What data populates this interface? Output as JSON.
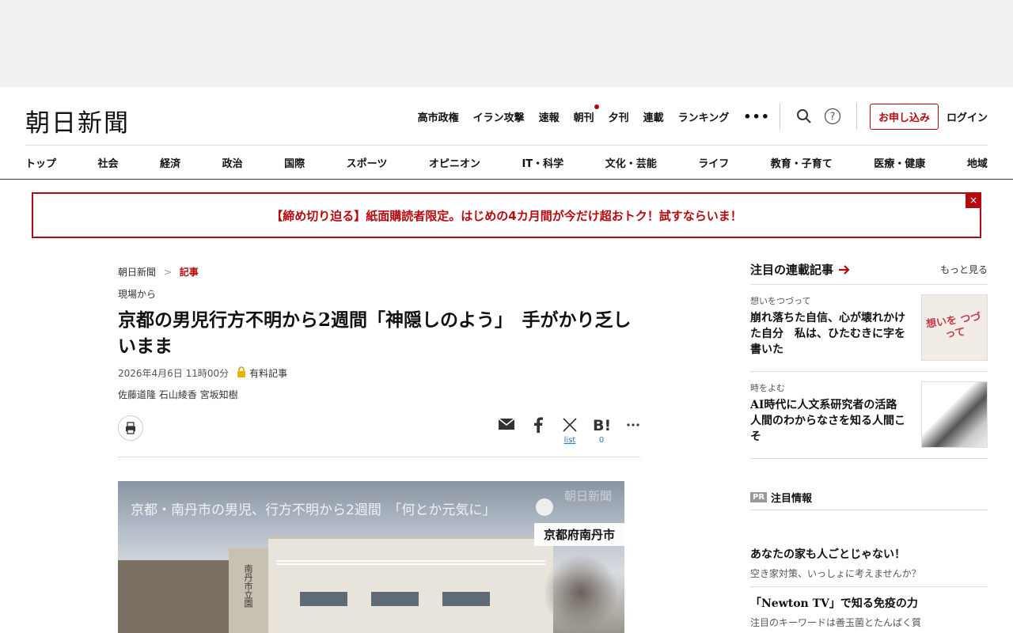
{
  "masthead": {
    "logo": "朝日新聞"
  },
  "topnav": {
    "links": [
      "高市政権",
      "イラン攻撃",
      "速報",
      "朝刊",
      "夕刊",
      "連載",
      "ランキング"
    ],
    "more": "•••",
    "subscribe": "お申し込み",
    "login": "ログイン"
  },
  "categories": [
    "トップ",
    "社会",
    "経済",
    "政治",
    "国際",
    "スポーツ",
    "オピニオン",
    "IT・科学",
    "文化・芸能",
    "ライフ",
    "教育・子育て",
    "医療・健康",
    "地域"
  ],
  "promo": {
    "text": "【締め切り迫る】紙面購読者限定。はじめの4カ月間が今だけ超おトク！試すならいま！",
    "close": "×"
  },
  "breadcrumb": {
    "home": "朝日新聞",
    "sep": ">",
    "current": "記事"
  },
  "article": {
    "kicker": "現場から",
    "headline": "京都の男児行方不明から2週間「神隠しのよう」　手がかり乏しいまま",
    "date": "2026年4月6日 11時00分",
    "paid": "有料記事",
    "authors": "佐藤道隆 石山綾香 宮坂知樹"
  },
  "share": {
    "x_count": "list",
    "hatena_count": "0"
  },
  "photo": {
    "caption": "京都・南丹市の男児、行方不明から2週間　「何とか元気に」",
    "watermark": "朝日新聞",
    "location": "京都府南丹市",
    "pillar_text": "南丹市立園"
  },
  "sidebar": {
    "title": "注目の連載記事",
    "more": "もっと見る",
    "items": [
      {
        "tag": "想いをつづって",
        "title": "崩れ落ちた自信、心が壊れかけた自分　私は、ひたむきに字を書いた",
        "thumb_text": "想いを つづって"
      },
      {
        "tag": "時をよむ",
        "title": "AI時代に人文系研究者の活路　人間のわからなさを知る人間こそ"
      }
    ]
  },
  "pr": {
    "badge": "PR",
    "label": "注目情報",
    "items": [
      {
        "headline": "あなたの家も人ごとじゃない！",
        "desc": "空き家対策、いっしょに考えませんか？"
      },
      {
        "headline": "「Newton TV」で知る免疫の力",
        "desc": "注目のキーワードは善玉菌とたんぱく質"
      }
    ]
  },
  "colors": {
    "accent": "#b5090e",
    "link": "#2a7ab0"
  }
}
